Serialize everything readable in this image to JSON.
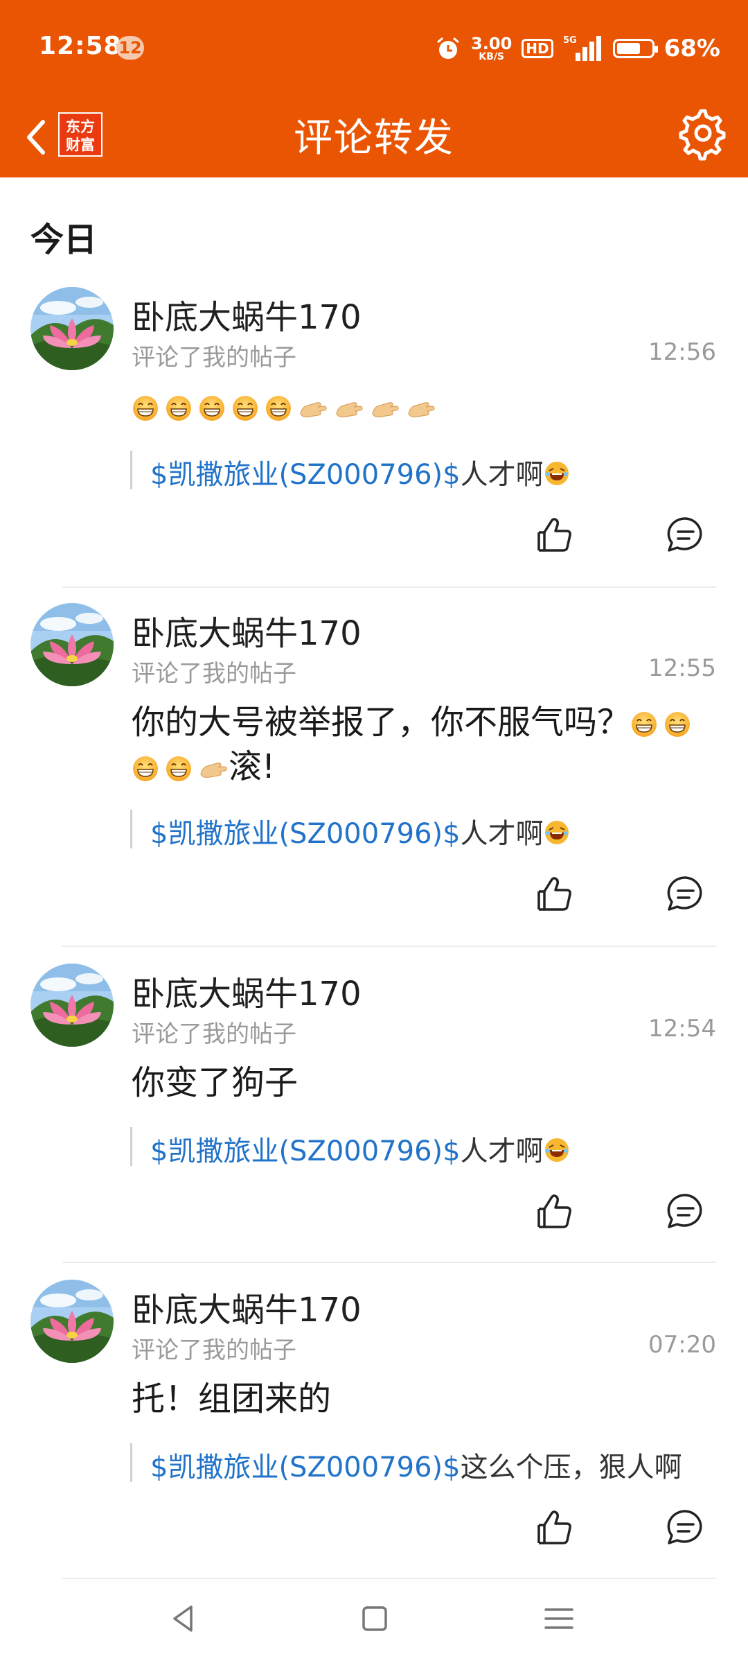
{
  "status_bar": {
    "time": "12:58",
    "notification_count": "12",
    "net_speed_value": "3.00",
    "net_speed_unit": "KB/S",
    "hd_label": "HD",
    "network": "5G",
    "battery": "68%"
  },
  "header": {
    "title": "评论转发",
    "logo_line1": "东方",
    "logo_line2": "财富",
    "accent_color": "#ea5504"
  },
  "section_title": "今日",
  "comments": [
    {
      "user": "卧底大蜗牛170",
      "action": "评论了我的帖子",
      "time": "12:56",
      "text": "",
      "emoji_sequence": [
        "grin",
        "grin",
        "grin",
        "grin",
        "grin",
        "hand",
        "hand",
        "hand",
        "hand"
      ],
      "quote_link": "$凯撒旅业(SZ000796)$",
      "quote_text": "人才啊",
      "quote_emoji": "laugh"
    },
    {
      "user": "卧底大蜗牛170",
      "action": "评论了我的帖子",
      "time": "12:55",
      "text_line1": "你的大号被举报了，你不服气吗？",
      "text_line2_end": "滚!",
      "quote_link": "$凯撒旅业(SZ000796)$",
      "quote_text": "人才啊",
      "quote_emoji": "laugh"
    },
    {
      "user": "卧底大蜗牛170",
      "action": "评论了我的帖子",
      "time": "12:54",
      "text": "你变了狗子",
      "quote_link": "$凯撒旅业(SZ000796)$",
      "quote_text": "人才啊",
      "quote_emoji": "laugh"
    },
    {
      "user": "卧底大蜗牛170",
      "action": "评论了我的帖子",
      "time": "07:20",
      "text": "托！组团来的",
      "quote_link": "$凯撒旅业(SZ000796)$",
      "quote_text": "这么个压，狠人啊",
      "quote_emoji": ""
    }
  ]
}
